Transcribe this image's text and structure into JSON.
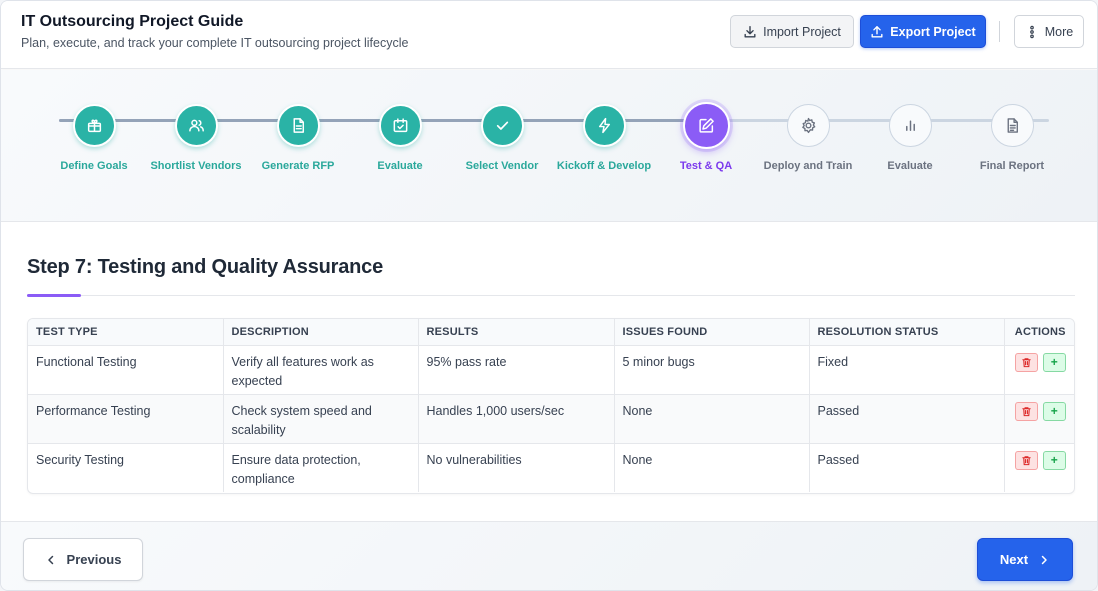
{
  "header": {
    "title": "IT Outsourcing Project Guide",
    "subtitle": "Plan, execute, and track your complete IT outsourcing project lifecycle",
    "import_label": "Import Project",
    "export_label": "Export Project",
    "more_label": "More"
  },
  "colors": {
    "primary": "#2563eb",
    "completed_step": "#2ab3a6",
    "active_step": "#8b5cf6",
    "pending_step": "#cbd5e1"
  },
  "steps": [
    {
      "label": "Define Goals",
      "status": "completed",
      "icon": "gift-icon"
    },
    {
      "label": "Shortlist Vendors",
      "status": "completed",
      "icon": "users-icon"
    },
    {
      "label": "Generate RFP",
      "status": "completed",
      "icon": "document-icon"
    },
    {
      "label": "Evaluate",
      "status": "completed",
      "icon": "calendar-check-icon"
    },
    {
      "label": "Select Vendor",
      "status": "completed",
      "icon": "check-icon"
    },
    {
      "label": "Kickoff & Develop",
      "status": "completed",
      "icon": "bolt-icon"
    },
    {
      "label": "Test & QA",
      "status": "active",
      "icon": "edit-icon"
    },
    {
      "label": "Deploy and Train",
      "status": "pending",
      "icon": "gear-icon"
    },
    {
      "label": "Evaluate",
      "status": "pending",
      "icon": "bar-chart-icon"
    },
    {
      "label": "Final Report",
      "status": "pending",
      "icon": "report-icon"
    }
  ],
  "section": {
    "title": "Step 7: Testing and Quality Assurance"
  },
  "table": {
    "headers": [
      "TEST TYPE",
      "DESCRIPTION",
      "RESULTS",
      "ISSUES FOUND",
      "RESOLUTION STATUS",
      "ACTIONS"
    ],
    "rows": [
      [
        "Functional Testing",
        "Verify all features work as expected",
        "95% pass rate",
        "5 minor bugs",
        "Fixed"
      ],
      [
        "Performance Testing",
        "Check system speed and scalability",
        "Handles 1,000 users/sec",
        "None",
        "Passed"
      ],
      [
        "Security Testing",
        "Ensure data protection, compliance",
        "No vulnerabilities",
        "None",
        "Passed"
      ]
    ],
    "add_symbol": "+"
  },
  "footer": {
    "previous_label": "Previous",
    "next_label": "Next"
  }
}
